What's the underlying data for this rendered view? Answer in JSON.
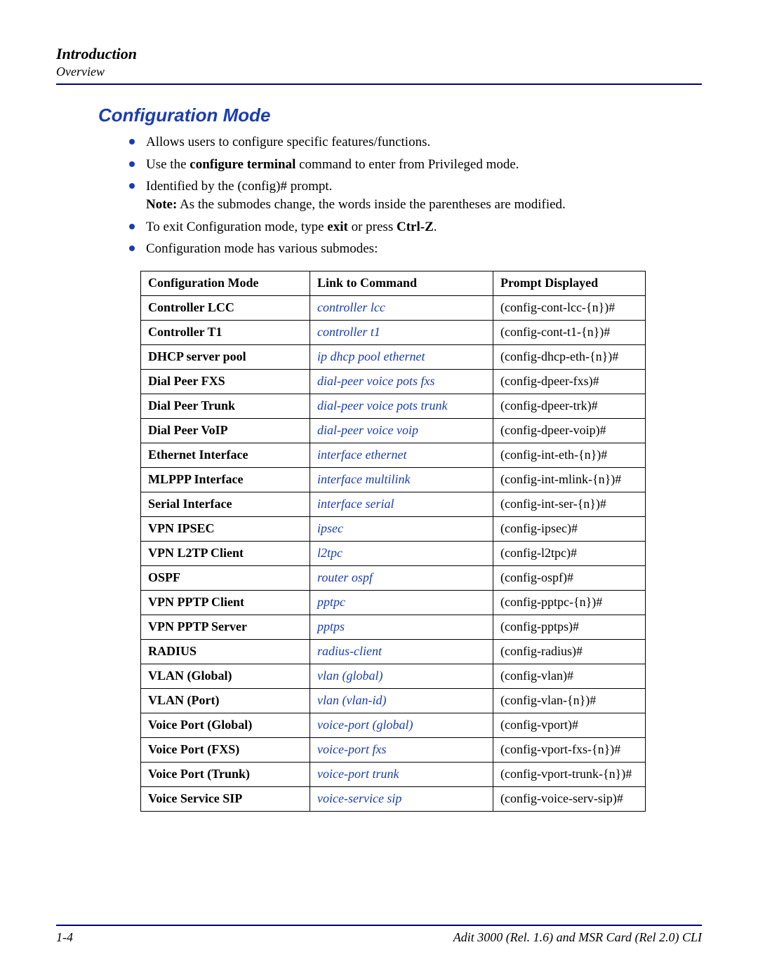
{
  "header": {
    "title": "Introduction",
    "subtitle": "Overview"
  },
  "section": {
    "title": "Configuration Mode"
  },
  "bullets": {
    "b1": "Allows users to configure specific features/functions.",
    "b2_pre": "Use the ",
    "b2_bold": "configure terminal",
    "b2_post": " command to enter from Privileged mode.",
    "b3_line1": "Identified by the (config)# prompt.",
    "b3_note_label": "Note:",
    "b3_note_text": " As the submodes change, the words inside the parentheses are modified.",
    "b4_pre": "To exit Configuration mode, type ",
    "b4_exit": "exit",
    "b4_mid": " or press ",
    "b4_ctrlz": "Ctrl-Z",
    "b4_post": ".",
    "b5": "Configuration mode has various submodes:"
  },
  "table": {
    "headers": {
      "mode": "Configuration Mode",
      "link": "Link to Command",
      "prompt": "Prompt Displayed"
    },
    "rows": [
      {
        "mode": "Controller LCC",
        "link": "controller lcc",
        "prompt": "(config-cont-lcc-{n})#"
      },
      {
        "mode": "Controller T1",
        "link": "controller t1",
        "prompt": "(config-cont-t1-{n})#"
      },
      {
        "mode": "DHCP server pool",
        "link": "ip dhcp pool ethernet",
        "prompt": "(config-dhcp-eth-{n})#"
      },
      {
        "mode": "Dial Peer FXS",
        "link": "dial-peer voice pots fxs",
        "prompt": "(config-dpeer-fxs)#"
      },
      {
        "mode": "Dial Peer Trunk",
        "link": "dial-peer voice pots trunk",
        "prompt": "(config-dpeer-trk)#"
      },
      {
        "mode": "Dial Peer VoIP",
        "link": "dial-peer voice voip",
        "prompt": "(config-dpeer-voip)#"
      },
      {
        "mode": "Ethernet Interface",
        "link": "interface ethernet",
        "prompt": "(config-int-eth-{n})#"
      },
      {
        "mode": "MLPPP Interface",
        "link": "interface multilink",
        "prompt": "(config-int-mlink-{n})#"
      },
      {
        "mode": "Serial Interface",
        "link": "interface serial",
        "prompt": "(config-int-ser-{n})#"
      },
      {
        "mode": "VPN IPSEC",
        "link": "ipsec",
        "prompt": "(config-ipsec)#"
      },
      {
        "mode": "VPN L2TP Client",
        "link": "l2tpc",
        "prompt": "(config-l2tpc)#"
      },
      {
        "mode": "OSPF",
        "link": "router ospf",
        "prompt": "(config-ospf)#"
      },
      {
        "mode": "VPN PPTP Client",
        "link": "pptpc",
        "prompt": "(config-pptpc-{n})#"
      },
      {
        "mode": "VPN PPTP Server",
        "link": "pptps",
        "prompt": "(config-pptps)#"
      },
      {
        "mode": "RADIUS",
        "link": "radius-client",
        "prompt": "(config-radius)#"
      },
      {
        "mode": "VLAN (Global)",
        "link": "vlan (global)",
        "prompt": "(config-vlan)#"
      },
      {
        "mode": "VLAN (Port)",
        "link": "vlan (vlan-id)",
        "prompt": "(config-vlan-{n})#"
      },
      {
        "mode": "Voice Port (Global)",
        "link": "voice-port (global)",
        "prompt": "(config-vport)#"
      },
      {
        "mode": "Voice Port (FXS)",
        "link": "voice-port fxs",
        "prompt": "(config-vport-fxs-{n})#"
      },
      {
        "mode": "Voice Port (Trunk)",
        "link": "voice-port trunk",
        "prompt": "(config-vport-trunk-{n})#"
      },
      {
        "mode": "Voice Service SIP",
        "link": "voice-service sip",
        "prompt": "(config-voice-serv-sip)#"
      }
    ]
  },
  "footer": {
    "page": "1-4",
    "doc": "Adit 3000 (Rel. 1.6) and MSR Card (Rel 2.0) CLI"
  }
}
